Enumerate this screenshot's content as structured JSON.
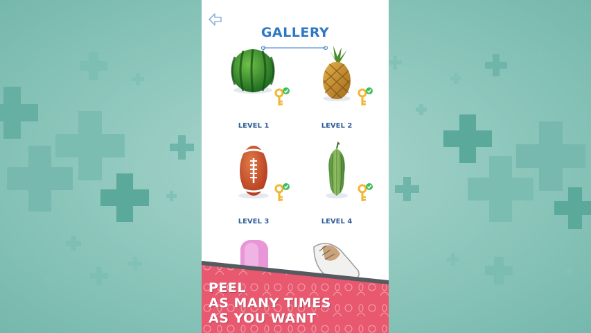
{
  "header": {
    "title": "GALLERY",
    "back_icon": "back-arrow-icon"
  },
  "levels": [
    {
      "label": "LEVEL 1",
      "item": "watermelon",
      "unlocked": true
    },
    {
      "label": "LEVEL 2",
      "item": "pineapple",
      "unlocked": true
    },
    {
      "label": "LEVEL 3",
      "item": "rugby-ball",
      "unlocked": true
    },
    {
      "label": "LEVEL 4",
      "item": "bitter-gourd",
      "unlocked": true
    },
    {
      "label": "",
      "item": "soap-bar",
      "unlocked": true
    },
    {
      "label": "",
      "item": "sneaker",
      "unlocked": true
    }
  ],
  "banner": {
    "line1": "PEEL",
    "line2": "AS MANY TIMES",
    "line3": "AS YOU WANT"
  },
  "colors": {
    "background": "#8cc6bb",
    "accent_title": "#2f78c4",
    "level_label": "#2f5d99",
    "key": "#f2b632",
    "check": "#3bbf5a",
    "banner": "#e8586f"
  }
}
